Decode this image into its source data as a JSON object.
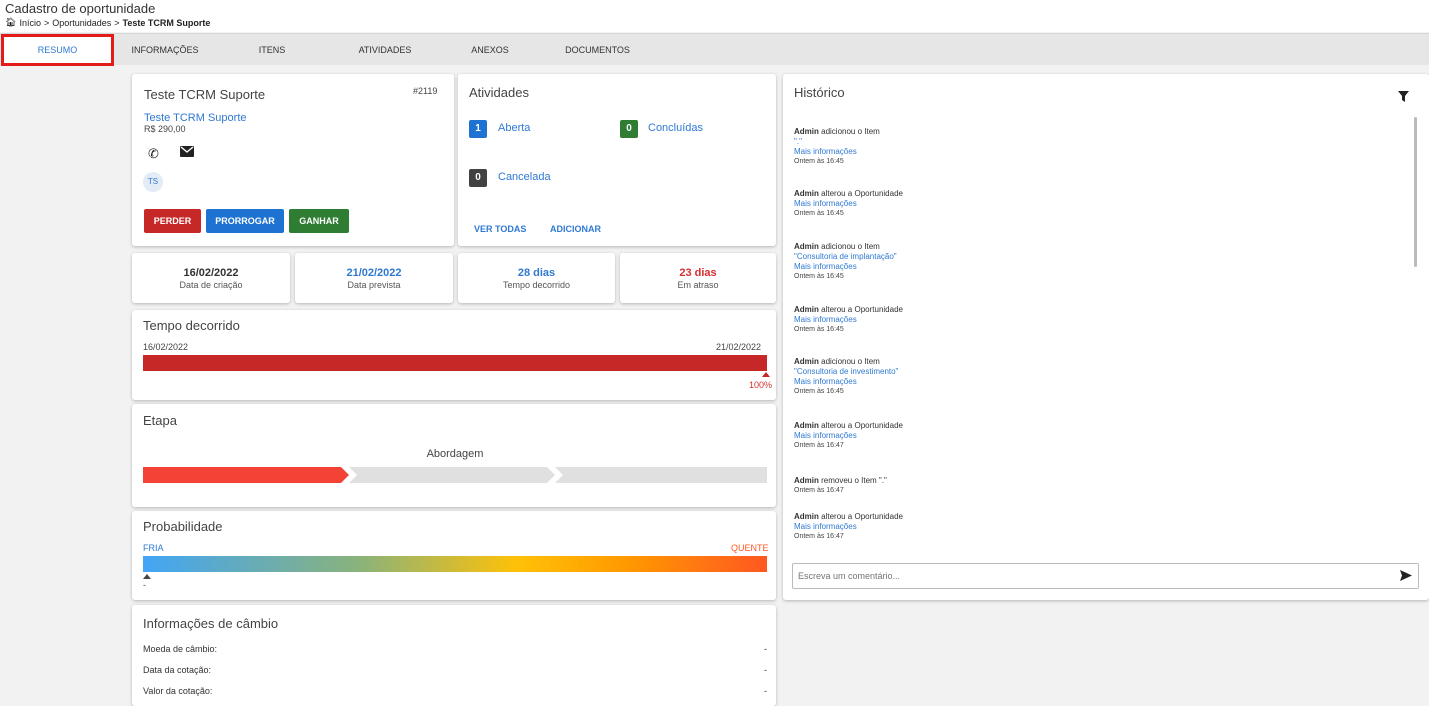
{
  "header": {
    "title": "Cadastro de oportunidade",
    "breadcrumb": [
      "Início",
      "Oportunidades",
      "Teste TCRM Suporte"
    ]
  },
  "tabs": [
    "RESUMO",
    "INFORMAÇÕES",
    "ITENS",
    "ATIVIDADES",
    "ANEXOS",
    "DOCUMENTOS"
  ],
  "opportunity": {
    "title": "Teste TCRM Suporte",
    "id": "#2119",
    "link": "Teste TCRM Suporte",
    "amount": "R$ 290,00",
    "avatar": "TS",
    "buttons": {
      "lose": "PERDER",
      "extend": "PRORROGAR",
      "win": "GANHAR"
    },
    "colors": {
      "lose": "#c62828",
      "extend": "#1e73d2",
      "win": "#2e7d32"
    }
  },
  "activities": {
    "title": "Atividades",
    "open_count": "1",
    "open_label": "Aberta",
    "done_count": "0",
    "done_label": "Concluídas",
    "cancel_count": "0",
    "cancel_label": "Cancelada",
    "view_all": "VER TODAS",
    "add": "ADICIONAR"
  },
  "stats": [
    {
      "value": "16/02/2022",
      "label": "Data de criação",
      "color": "#333333"
    },
    {
      "value": "21/02/2022",
      "label": "Data prevista",
      "color": "#2f79d3"
    },
    {
      "value": "28 dias",
      "label": "Tempo decorrido",
      "color": "#2f79d3"
    },
    {
      "value": "23 dias",
      "label": "Em atraso",
      "color": "#d32f2f"
    }
  ],
  "elapsed": {
    "title": "Tempo decorrido",
    "start": "16/02/2022",
    "end": "21/02/2022",
    "percent_label": "100%",
    "progress": 1.0,
    "color": "#c62828"
  },
  "stage": {
    "title": "Etapa",
    "current": "Abordagem",
    "steps_total": 3,
    "steps_done": 1
  },
  "probability": {
    "title": "Probabilidade",
    "low": "FRIA",
    "high": "QUENTE",
    "value": "-"
  },
  "exchange": {
    "title": "Informações de câmbio",
    "rows": [
      {
        "label": "Moeda de câmbio:",
        "value": "-"
      },
      {
        "label": "Data da cotação:",
        "value": "-"
      },
      {
        "label": "Valor da cotação:",
        "value": "-"
      }
    ]
  },
  "history": {
    "title": "Histórico",
    "comment_placeholder": "Escreva um comentário...",
    "entries": [
      {
        "who": "Admin",
        "action": "adicionou o Item",
        "item": "\".\"",
        "more": "Mais informações",
        "time": "Ontem às 16:45"
      },
      {
        "who": "Admin",
        "action": "alterou a Oportunidade",
        "item": "",
        "more": "Mais informações",
        "time": "Ontem às 16:45"
      },
      {
        "who": "Admin",
        "action": "adicionou o Item",
        "item": "\"Consultoria de implantação\"",
        "more": "Mais informações",
        "time": "Ontem às 16:45"
      },
      {
        "who": "Admin",
        "action": "alterou a Oportunidade",
        "item": "",
        "more": "Mais informações",
        "time": "Ontem às 16:45"
      },
      {
        "who": "Admin",
        "action": "adicionou o Item",
        "item": "\"Consultoria de investimento\"",
        "more": "Mais informações",
        "time": "Ontem às 16:45"
      },
      {
        "who": "Admin",
        "action": "alterou a Oportunidade",
        "item": "",
        "more": "Mais informações",
        "time": "Ontem às 16:47"
      },
      {
        "who": "Admin",
        "action": "removeu o Item \".\"",
        "item": "",
        "more": "",
        "time": "Ontem às 16:47"
      },
      {
        "who": "Admin",
        "action": "alterou a Oportunidade",
        "item": "",
        "more": "Mais informações",
        "time": "Ontem às 16:47"
      }
    ]
  }
}
